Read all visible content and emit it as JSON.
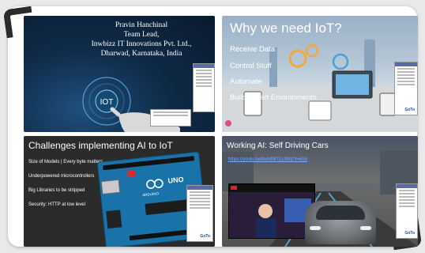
{
  "tiles": {
    "t1": {
      "lines": [
        "Pravin Hanchinal",
        "Team Lead,",
        "Inwbizz IT Innovations Pvt. Ltd.,",
        "Dharwad, Karnataka, India"
      ],
      "badge": "IOT"
    },
    "t2": {
      "title": "Why we need IoT?",
      "items": [
        "Receive Data",
        "Control Stuff",
        "Automate",
        "Build Smart Environments"
      ]
    },
    "t3": {
      "title": "Challenges implementing AI to IoT",
      "items": [
        "Size of Models | Every byte matters",
        "Underpowered microcontrollers",
        "Big Libraries to be stripped",
        "Security: HTTP at low level"
      ],
      "board_label": "UNO",
      "board_brand": "ARDUINO"
    },
    "t4": {
      "title": "Working AI: Self Driving Cars",
      "link": "https://youtu.be/tiwVMrTLUWg?t=616"
    }
  },
  "side_panel": {
    "logo": "GoTo"
  },
  "colors": {
    "frame": "#ffffff",
    "corner": "#2a2a2a",
    "link": "#6fb0ff"
  }
}
